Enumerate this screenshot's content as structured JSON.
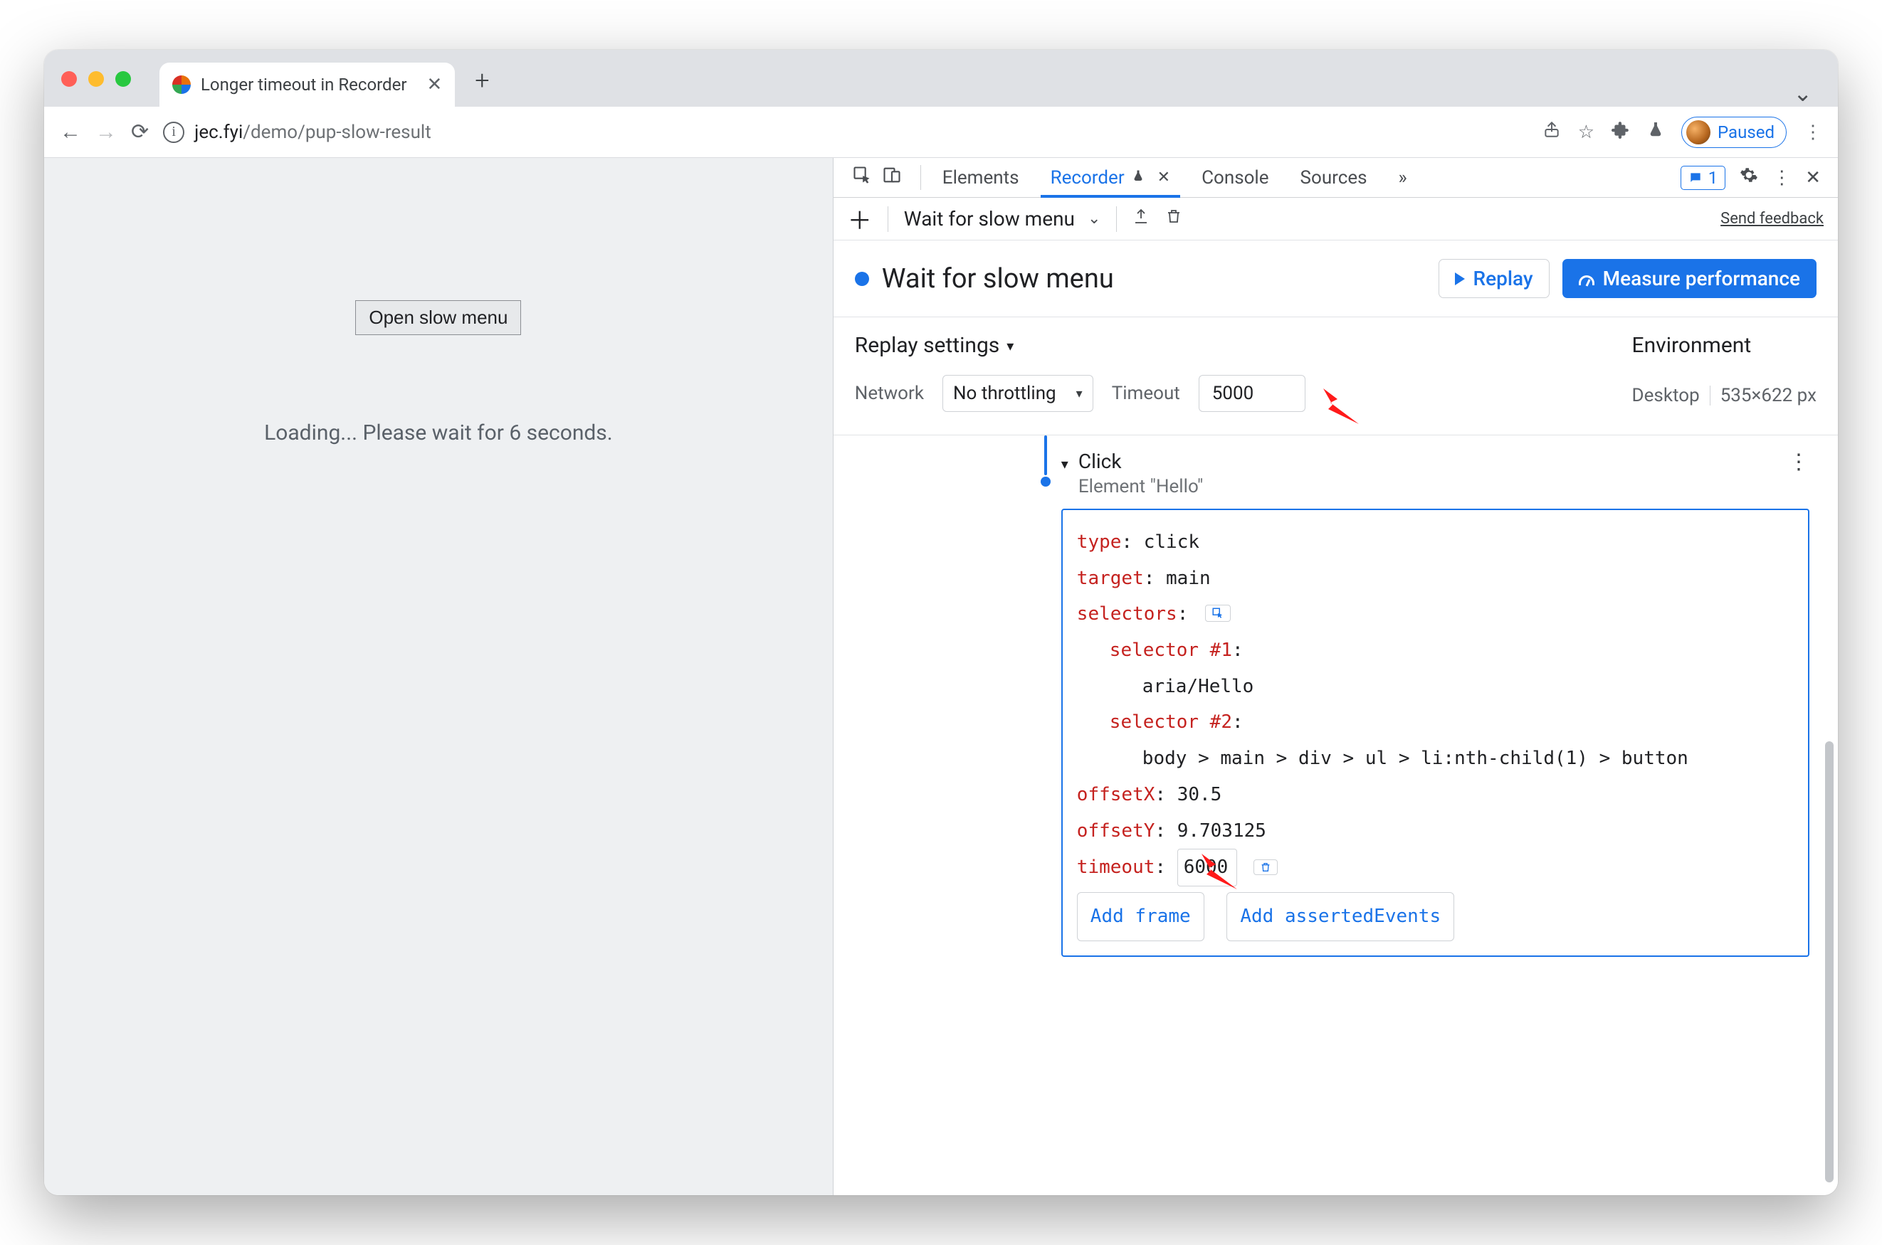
{
  "browser": {
    "tab_title": "Longer timeout in Recorder",
    "url_root": "jec.fyi",
    "url_rest": "/demo/pup-slow-result",
    "profile_state": "Paused"
  },
  "page": {
    "button_label": "Open slow menu",
    "loading_text": "Loading... Please wait for 6 seconds."
  },
  "devtools": {
    "tabs": {
      "elements": "Elements",
      "recorder": "Recorder",
      "console": "Console",
      "sources": "Sources"
    },
    "issues_count": "1",
    "toolbar": {
      "current_recording": "Wait for slow menu",
      "send_feedback": "Send feedback"
    },
    "header": {
      "title": "Wait for slow menu",
      "replay": "Replay",
      "measure": "Measure performance"
    },
    "settings": {
      "title": "Replay settings",
      "network_label": "Network",
      "network_value": "No throttling",
      "timeout_label": "Timeout",
      "timeout_value": "5000",
      "env_title": "Environment",
      "env_device": "Desktop",
      "env_size": "535×622 px"
    },
    "step": {
      "title": "Click",
      "subtitle": "Element \"Hello\"",
      "type_label": "type",
      "type_value": "click",
      "target_label": "target",
      "target_value": "main",
      "selectors_label": "selectors",
      "sel1_label": "selector #1",
      "sel1_value": "aria/Hello",
      "sel2_label": "selector #2",
      "sel2_value": "body > main > div > ul > li:nth-child(1) > button",
      "offsetx_label": "offsetX",
      "offsetx_value": "30.5",
      "offsety_label": "offsetY",
      "offsety_value": "9.703125",
      "timeout_label": "timeout",
      "timeout_value": "6000",
      "add_frame": "Add frame",
      "add_asserted": "Add assertedEvents"
    }
  }
}
